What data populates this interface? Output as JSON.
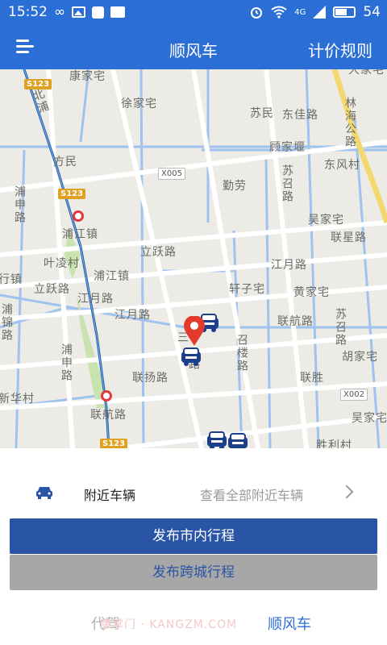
{
  "status": {
    "time": "15:52",
    "infinity": "∞",
    "network": "4G",
    "battery": "54"
  },
  "header": {
    "title": "顺风车",
    "rule_link": "计价规则"
  },
  "map": {
    "labels": {
      "kangjiazhai": "康家宅",
      "xujiazhai": "徐家宅",
      "suminl": "苏民",
      "dongjia_road": "东佳路",
      "dajiazhai": "大家宅",
      "gujiayan": "顾家堰",
      "dongfengcun": "东风村",
      "qinlao": "勤劳",
      "wujiazhai_n": "吴家宅",
      "lianxing_road": "联星路",
      "fangmin": "方民",
      "pujiang_town": "浦江镇",
      "yeling_village": "叶凌村",
      "pujiang_town2": "浦江镇",
      "liyue_road": "立跃路",
      "jiangyue_road": "江月路",
      "xuanzhai": "轩子宅",
      "huangjiazhai": "黄家宅",
      "xingzhen": "行镇",
      "liyue_road2": "立跃路",
      "jiangyue_road2": "江月路",
      "jiangyue_road3": "江月路",
      "lianhang_road": "联航路",
      "hujiazhai": "胡家宅",
      "lianyang_road": "联扬路",
      "liansheng": "联胜",
      "xinhua_village": "新华村",
      "lianhang_road2": "联航路",
      "wujiazhai_s": "吴家宅",
      "shengli_village": "胜利村",
      "pu_rd": "浦",
      "san": "三"
    },
    "vlabels": {
      "beiyu_road": "北浦",
      "linhai_road": "林海公路",
      "suzhao_road": "苏召路",
      "pushen_road": "浦申路",
      "puxi_road": "浦锦路",
      "zhaolou_road": "召楼路",
      "suzhao_road2": "苏召路",
      "pumin_road": "浦申路",
      "lu": "路"
    },
    "shields": {
      "s123_top": "S123",
      "s123_mid": "S123",
      "s123_bottom": "S123",
      "x005": "X005",
      "x002": "X002"
    }
  },
  "panel": {
    "nearby_label": "附近车辆",
    "nearby_link": "查看全部附近车辆",
    "btn_city": "发布市内行程",
    "btn_intercity": "发布跨城行程"
  },
  "tabs": {
    "daijia": "代驾",
    "shunfeng": "顺风车",
    "watermark": "康掌门 · KANGZM.COM"
  },
  "colors": {
    "brand_blue": "#2b6fd6",
    "primary_button": "#2a55a6",
    "secondary_button": "#a7a7a7",
    "pin_red": "#e23b2c"
  },
  "icons": {
    "menu": "hamburger-menu-icon",
    "car": "car-icon",
    "chevron": "chevron-right-icon",
    "pin": "location-pin-icon"
  }
}
